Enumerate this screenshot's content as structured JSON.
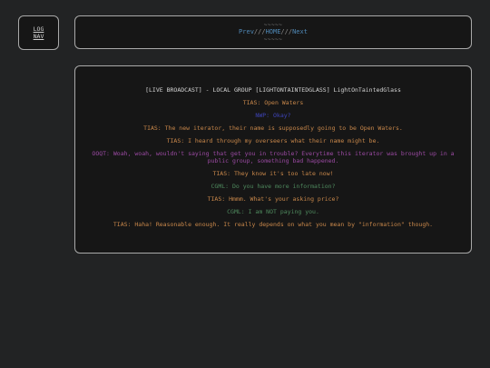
{
  "colors": {
    "background": "#222324",
    "panel": "#161616",
    "border": "#a9a9a9",
    "link": "#4f88b6"
  },
  "log": {
    "line1": "LOG",
    "line2": "NAV"
  },
  "nav": {
    "deco_top": "~~~~~",
    "prev": "Prev",
    "sep1": "///",
    "home": "HOME",
    "sep2": "///",
    "next": "Next",
    "deco_bottom": "~~~~~"
  },
  "chat": {
    "header": "[LIVE BROADCAST] - LOCAL GROUP [LIGHTONTAINTEDGLASS] LightOnTaintedGlass",
    "messages": [
      {
        "text": "TIAS: Open Waters",
        "color": "#c8874a"
      },
      {
        "text": "NWP: Okay?",
        "color": "#3e44b8"
      },
      {
        "text": "TIAS: The new iterator, their name is supposedly going to be Open Waters.",
        "color": "#c8874a"
      },
      {
        "text": "TIAS: I heard through my overseers what their name might be.",
        "color": "#c8874a"
      },
      {
        "text": "OOQT: Woah, woah, wouldn't saying that get you in trouble? Everytime this iterator was brought up in a public group, something bad happened.",
        "color": "#9b4aa3"
      },
      {
        "text": "TIAS: They know it's too late now!",
        "color": "#c8874a"
      },
      {
        "text": "CGML: Do you have more information?",
        "color": "#4f8a5e"
      },
      {
        "text": "TIAS: Hmmm. What's your asking price?",
        "color": "#c8874a"
      },
      {
        "text": "CGML: I am NOT paying you.",
        "color": "#4f8a5e"
      },
      {
        "text": "TIAS: Haha! Reasonable enough. It really depends on what you mean by \"information\" though.",
        "color": "#c8874a"
      }
    ]
  }
}
